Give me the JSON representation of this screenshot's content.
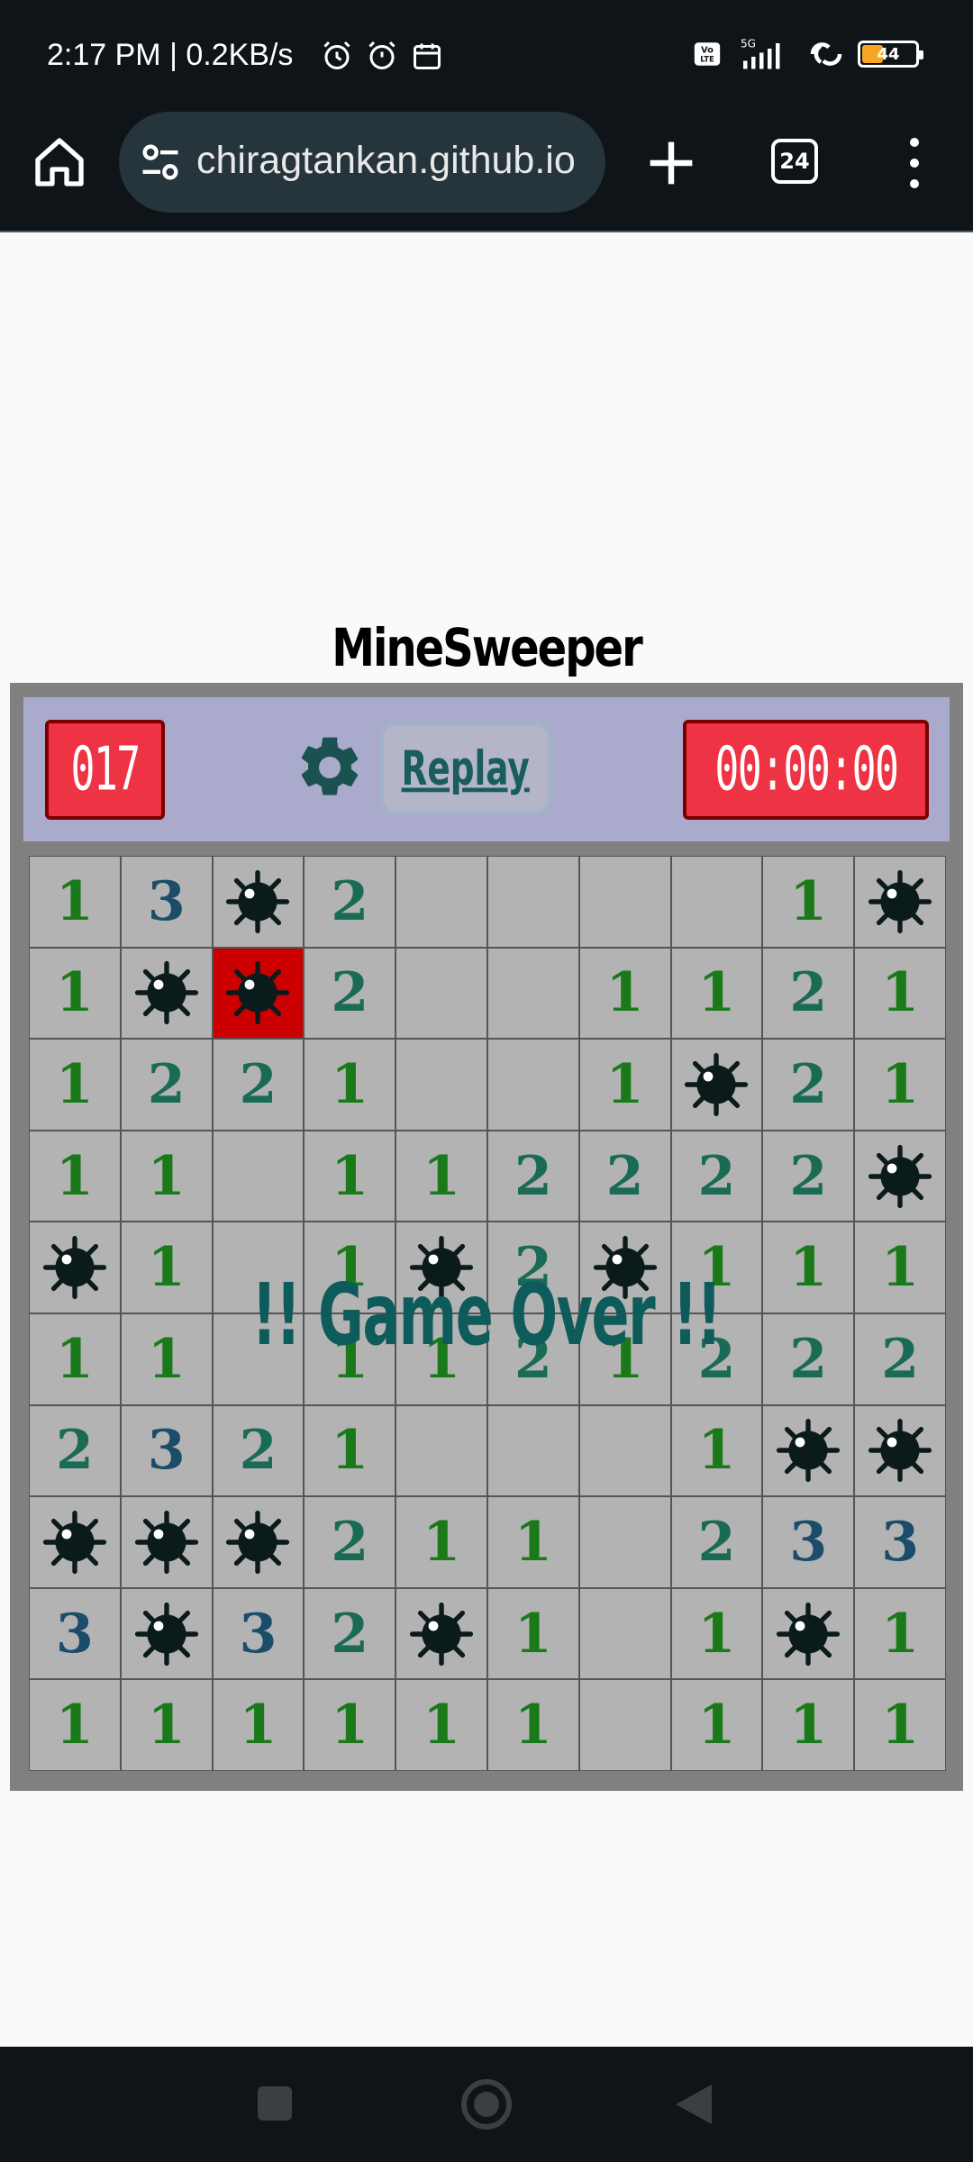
{
  "status": {
    "time": "2:17 PM | 0.2KB/s",
    "network": "5G",
    "volte": "Vo LTE",
    "battery": "44",
    "battery_level": 0.44
  },
  "browser": {
    "url": "chiragtankan.github.io",
    "tab_count": "24"
  },
  "game": {
    "title": "MineSweeper",
    "mine_counter": "017",
    "timer": "00:00:00",
    "replay_label": "Replay",
    "game_over_text": "!! Game Over !!",
    "grid": [
      [
        "1",
        "3",
        "M",
        "2",
        "",
        "",
        "",
        "",
        "1",
        "M"
      ],
      [
        "1",
        "M",
        "X",
        "2",
        "",
        "",
        "1",
        "1",
        "2",
        "1"
      ],
      [
        "1",
        "2",
        "2",
        "1",
        "",
        "",
        "1",
        "M",
        "2",
        "1"
      ],
      [
        "1",
        "1",
        "",
        "1",
        "1",
        "2",
        "2",
        "2",
        "2",
        "M"
      ],
      [
        "M",
        "1",
        "",
        "1",
        "M",
        "2",
        "M",
        "1",
        "1",
        "1"
      ],
      [
        "1",
        "1",
        "",
        "1",
        "1",
        "2",
        "1",
        "2",
        "2",
        "2"
      ],
      [
        "2",
        "3",
        "2",
        "1",
        "",
        "",
        "",
        "1",
        "M",
        "M"
      ],
      [
        "M",
        "M",
        "M",
        "2",
        "1",
        "1",
        "",
        "2",
        "3",
        "3"
      ],
      [
        "3",
        "M",
        "3",
        "2",
        "M",
        "1",
        "",
        "1",
        "M",
        "1"
      ],
      [
        "1",
        "1",
        "1",
        "1",
        "1",
        "1",
        "",
        "1",
        "1",
        "1"
      ]
    ]
  },
  "colors": {
    "counter_bg": "#ee3344",
    "header_bg": "#aaaacc",
    "cell_bg": "#b3b3b3",
    "exploded_bg": "#cc0000",
    "game_over": "#0d5b5b"
  }
}
